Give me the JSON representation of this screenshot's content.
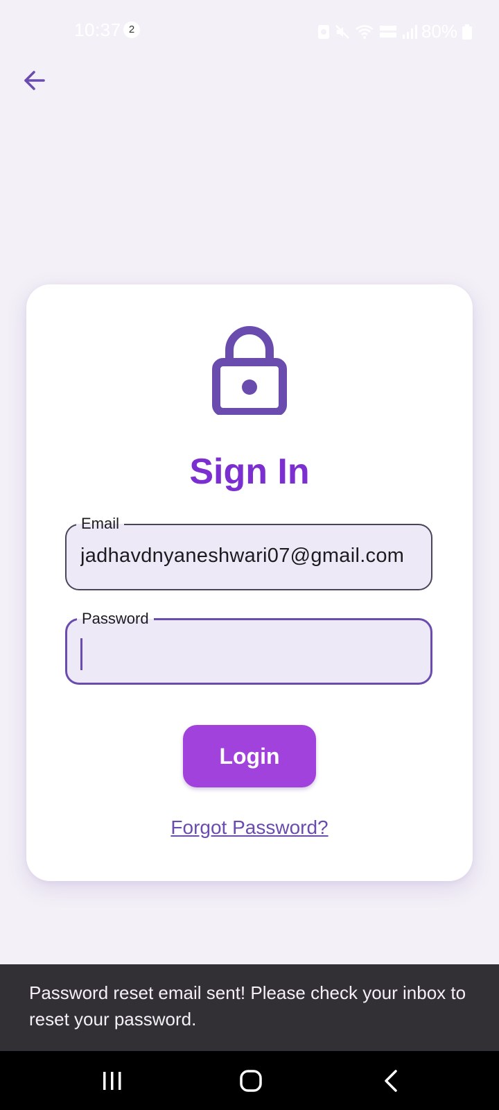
{
  "status_bar": {
    "time": "10:37",
    "notification_count": "2",
    "battery": "80%",
    "icons": [
      "media-icon",
      "mute-icon",
      "wifi-icon",
      "volte-icon",
      "signal-icon",
      "battery-icon"
    ]
  },
  "navigation": {
    "back_icon": "arrow-left-icon"
  },
  "card": {
    "icon": "lock-icon",
    "title": "Sign In",
    "email": {
      "label": "Email",
      "value": "jadhavdnyaneshwari07@gmail.com"
    },
    "password": {
      "label": "Password",
      "value": ""
    },
    "login_label": "Login",
    "forgot_label": "Forgot Password?"
  },
  "snackbar": {
    "message": "Password reset email sent! Please check your inbox to reset your password."
  },
  "system_nav": {
    "items": [
      "recents-icon",
      "home-icon",
      "back-icon"
    ]
  },
  "colors": {
    "background": "#f3f0f7",
    "primary": "#6a4bae",
    "title": "#7b2fd0",
    "button": "#a142dc",
    "field_fill": "#eee9f7",
    "snackbar": "#322f35"
  }
}
